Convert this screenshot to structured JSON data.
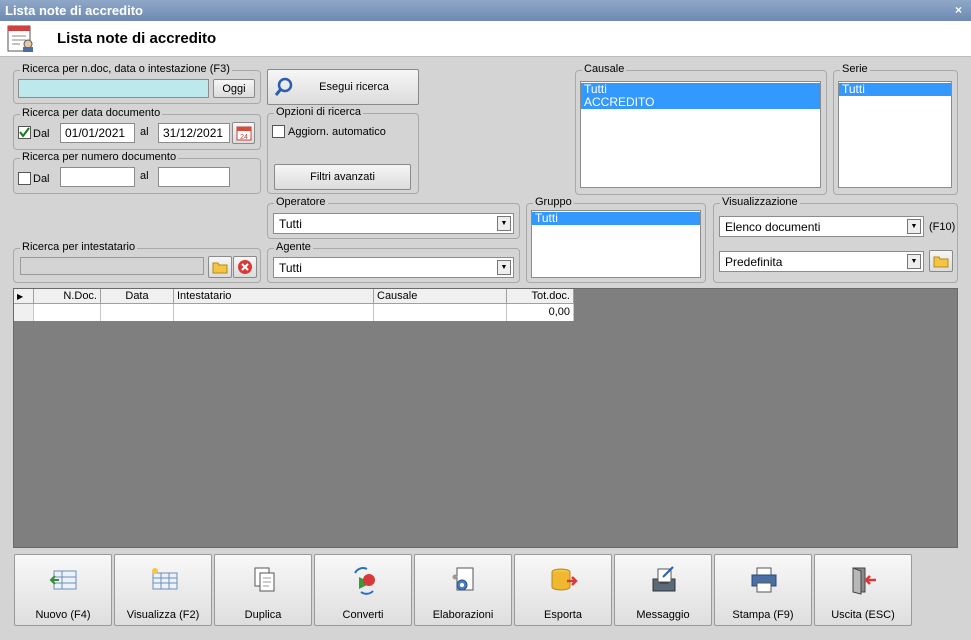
{
  "window": {
    "title": "Lista note di accredito",
    "close_glyph": "×"
  },
  "header": {
    "title": "Lista note di accredito",
    "icon": "document-list-icon"
  },
  "search_text": {
    "legend": "Ricerca per n.doc, data o intestazione (F3)",
    "value": "",
    "oggi_label": "Oggi"
  },
  "run_search": {
    "label": "Esegui ricerca"
  },
  "date_search": {
    "legend": "Ricerca per data documento",
    "checked": true,
    "dal_label": "Dal",
    "from": "01/01/2021",
    "al_label": "al",
    "to": "31/12/2021"
  },
  "number_search": {
    "legend": "Ricerca per numero documento",
    "checked": false,
    "dal_label": "Dal",
    "from": "",
    "al_label": "al",
    "to": ""
  },
  "options": {
    "legend": "Opzioni di ricerca",
    "auto_update_label": "Aggiorn. automatico",
    "auto_update": false,
    "advanced_label": "Filtri avanzati"
  },
  "causale": {
    "legend": "Causale",
    "items": [
      "Tutti",
      "ACCREDITO"
    ]
  },
  "serie": {
    "legend": "Serie",
    "items": [
      "Tutti"
    ]
  },
  "operatore": {
    "legend": "Operatore",
    "value": "Tutti"
  },
  "agente": {
    "legend": "Agente",
    "value": "Tutti"
  },
  "gruppo": {
    "legend": "Gruppo",
    "items": [
      "Tutti"
    ]
  },
  "visualizzazione": {
    "legend": "Visualizzazione",
    "view": "Elenco documenti",
    "view_hotkey": "(F10)",
    "layout": "Predefinita"
  },
  "intestatario": {
    "legend": "Ricerca per intestatario",
    "value": ""
  },
  "grid": {
    "columns": [
      "N.Doc.",
      "Data",
      "Intestatario",
      "Causale",
      "Tot.doc."
    ],
    "rows": [
      [
        "",
        "",
        "",
        "",
        "0,00"
      ]
    ]
  },
  "toolbar": {
    "buttons": [
      {
        "label": "Nuovo (F4)",
        "icon": "new-document-icon"
      },
      {
        "label": "Visualizza (F2)",
        "icon": "view-table-icon"
      },
      {
        "label": "Duplica",
        "icon": "duplicate-icon"
      },
      {
        "label": "Converti",
        "icon": "convert-icon"
      },
      {
        "label": "Elaborazioni",
        "icon": "process-gear-icon"
      },
      {
        "label": "Esporta",
        "icon": "export-database-icon"
      },
      {
        "label": "Messaggio",
        "icon": "message-icon"
      },
      {
        "label": "Stampa (F9)",
        "icon": "printer-icon"
      },
      {
        "label": "Uscita (ESC)",
        "icon": "exit-door-icon"
      }
    ]
  },
  "colors": {
    "selection": "#3399ff",
    "search_field": "#bde9ec",
    "grid_bg": "#7f7f7f"
  }
}
